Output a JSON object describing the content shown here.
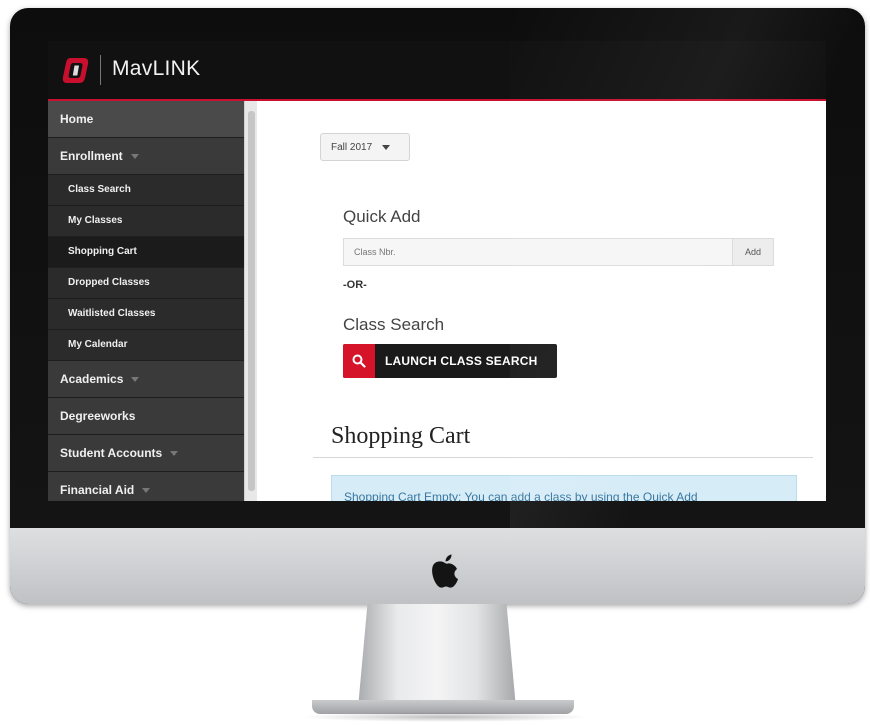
{
  "app": {
    "title": "MavLINK",
    "logo_icon": "university-o-logo",
    "accent": "#c8102e"
  },
  "sidebar": {
    "items": [
      {
        "label": "Home",
        "level": "top",
        "caret": false,
        "active": false
      },
      {
        "label": "Enrollment",
        "level": "top",
        "caret": true,
        "active": false
      },
      {
        "label": "Class Search",
        "level": "sub",
        "caret": false,
        "active": false
      },
      {
        "label": "My Classes",
        "level": "sub",
        "caret": false,
        "active": false
      },
      {
        "label": "Shopping Cart",
        "level": "sub",
        "caret": false,
        "active": true
      },
      {
        "label": "Dropped Classes",
        "level": "sub",
        "caret": false,
        "active": false
      },
      {
        "label": "Waitlisted Classes",
        "level": "sub",
        "caret": false,
        "active": false
      },
      {
        "label": "My Calendar",
        "level": "sub",
        "caret": false,
        "active": false
      },
      {
        "label": "Academics",
        "level": "top",
        "caret": true,
        "active": false
      },
      {
        "label": "Degreeworks",
        "level": "top",
        "caret": false,
        "active": false
      },
      {
        "label": "Student Accounts",
        "level": "top",
        "caret": true,
        "active": false
      },
      {
        "label": "Financial Aid",
        "level": "top",
        "caret": true,
        "active": false
      }
    ]
  },
  "main": {
    "term_select": {
      "value": "Fall 2017"
    },
    "quick_add": {
      "title": "Quick Add",
      "placeholder": "Class Nbr.",
      "button_label": "Add"
    },
    "or_label": "-OR-",
    "class_search": {
      "title": "Class Search",
      "button_label": "LAUNCH CLASS SEARCH",
      "icon": "search-icon"
    },
    "shopping_cart": {
      "title": "Shopping Cart",
      "alert": "Shopping Cart Empty: You can add a class by using the Quick Add"
    }
  },
  "colors": {
    "alert_bg": "#d6ecf7",
    "button_red": "#d5142a",
    "sidebar_bg": "#2e2e2e"
  }
}
